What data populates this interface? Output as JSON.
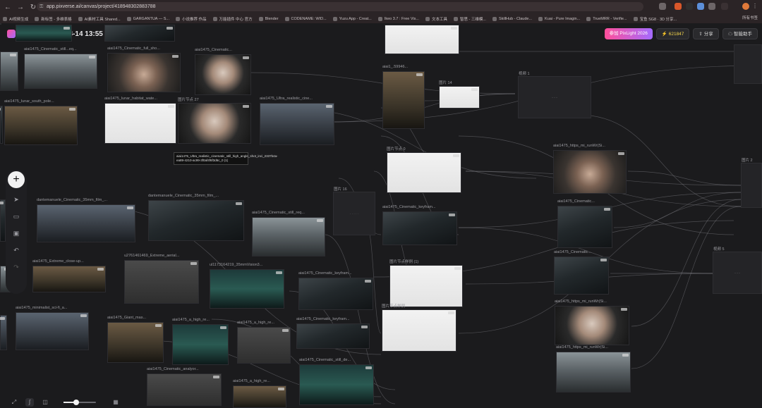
{
  "browser": {
    "url": "app.pixverse.ai/canvas/project/41894830288378​8",
    "bookmarks": [
      "AI视频生成",
      "新标签 - 多维表格",
      "AI素材工具 Shared...",
      "GARGANTUA — S...",
      "小说推荐 作品",
      "万能插件 中心 官方",
      "Blender",
      "CODENAME: WID...",
      "Yuzu App - Creat...",
      "Ikeo 3.7 : Free Vis...",
      "文本工具",
      "智思 - 三维模...",
      "SkillHub - Claude...",
      "Kuai - Pure Imagin...",
      "TrueMRR - Verifie...",
      "宝鱼 SG8 · 3D 分享..."
    ],
    "bookmarks_right": "所有书签"
  },
  "app": {
    "title": "Canvas 2026-08-14 13:55",
    "promo_label": "参加 PixLight 2026",
    "credits": "621847",
    "share_label": "分享",
    "assistant_label": "智能助手"
  },
  "nodes": [
    {
      "caption": "aiai1475_Cinematic_still...eq...",
      "style": "g-sky"
    },
    {
      "caption": "aiai1475_Cinematic_full_sho...",
      "style": "g-face2"
    },
    {
      "caption": "aiai1475_Cinematic...",
      "style": "g-face"
    },
    {
      "caption": "aiai1475_lunar_south_pole...",
      "style": "g-warm"
    },
    {
      "caption": "aiai1475_lunar_habitat_wate...",
      "style": "g-white"
    },
    {
      "caption": "图片节点 27",
      "style": "g-face"
    },
    {
      "caption": "aiai1475_Ultra_realistic_cine...",
      "style": "g-blue"
    },
    {
      "caption": "aiai1_.59946...",
      "style": "g-warm"
    },
    {
      "caption": "图片 14",
      "style": "g-white"
    },
    {
      "caption": "图片节点 0",
      "style": "g-white"
    },
    {
      "caption": "dantemanuele_Cinematic_35mm_film_...",
      "style": "g-blue"
    },
    {
      "caption": "dantemanuele_Cinematic_35mm_film_...",
      "style": "g-dark"
    },
    {
      "caption": "aiai1475_Cinematic_still_req...",
      "style": "g-sky"
    },
    {
      "caption": "aiai1475_Cinematic_keyfram...",
      "style": "g-dark"
    },
    {
      "caption": "aiai1475_Extreme_close-up...",
      "style": "g-warm"
    },
    {
      "caption": "u2761461469_Extreme_aerial...",
      "style": "g-grey"
    },
    {
      "caption": "ul1173164219_35mmVision3...",
      "style": "g-teal"
    },
    {
      "caption": "aiai1475_Cinematic_keyfram...",
      "style": "g-dark"
    },
    {
      "caption": "图片节点样例 (1)",
      "style": "g-white"
    },
    {
      "caption": "aiai1475_minimalist_sci-fi_a...",
      "style": "g-blue"
    },
    {
      "caption": "aiai1475_Giant_mas...",
      "style": "g-warm"
    },
    {
      "caption": "aiai1475_a_high_re...",
      "style": "g-teal"
    },
    {
      "caption": "aiai1475_a_high_re...",
      "style": "g-grey"
    },
    {
      "caption": "aiai1475_Cinematic_keyfram...",
      "style": "g-dark"
    },
    {
      "caption": "图片节点样例",
      "style": "g-white"
    },
    {
      "caption": "aiai1475_Cinematic_analyor...",
      "style": "g-grey"
    },
    {
      "caption": "aiai1475_a_high_re...",
      "style": "g-warm"
    },
    {
      "caption": "aiai1475_Cinematic_still_de...",
      "style": "g-teal"
    },
    {
      "caption": "aiai1475_https_mi_runWr(Si...",
      "style": "g-face2"
    },
    {
      "caption": "aiai1475_Cinematic...",
      "style": "g-dark"
    },
    {
      "caption": "aiai1475_Cinematic...",
      "style": "g-dark"
    },
    {
      "caption": "aiai1475_https_mi_runWr(Si...",
      "style": "g-face"
    },
    {
      "caption": "aiai1475_https_mi_runWr(Si...",
      "style": "g-sky"
    },
    {
      "caption": "",
      "style": "g-teal"
    },
    {
      "caption": "",
      "style": "g-dark"
    },
    {
      "caption": "",
      "style": "g-sky"
    },
    {
      "caption": "",
      "style": "g-dark"
    },
    {
      "caption": "",
      "style": "g-white"
    },
    {
      "caption": "",
      "style": "g-dark"
    },
    {
      "caption": "",
      "style": "g-sky"
    },
    {
      "caption": "",
      "style": "g-blue"
    },
    {
      "caption": "",
      "style": "g-sky"
    }
  ],
  "panels": [
    {
      "title": "视频 1",
      "inner": "······"
    },
    {
      "title": "图片 16",
      "inner": "· · · · ·"
    },
    {
      "title": "图片 2",
      "inner": ""
    },
    {
      "title": "视频 5",
      "inner": "······"
    },
    {
      "title": "",
      "inner": ""
    }
  ],
  "tooltip": "aiai1475_Ultra_realistic_cinematic_still_high_angle_shot_inci_2337b4a-ea89-4210-ac99-3f0af4f6f3d6c_0 (1)"
}
